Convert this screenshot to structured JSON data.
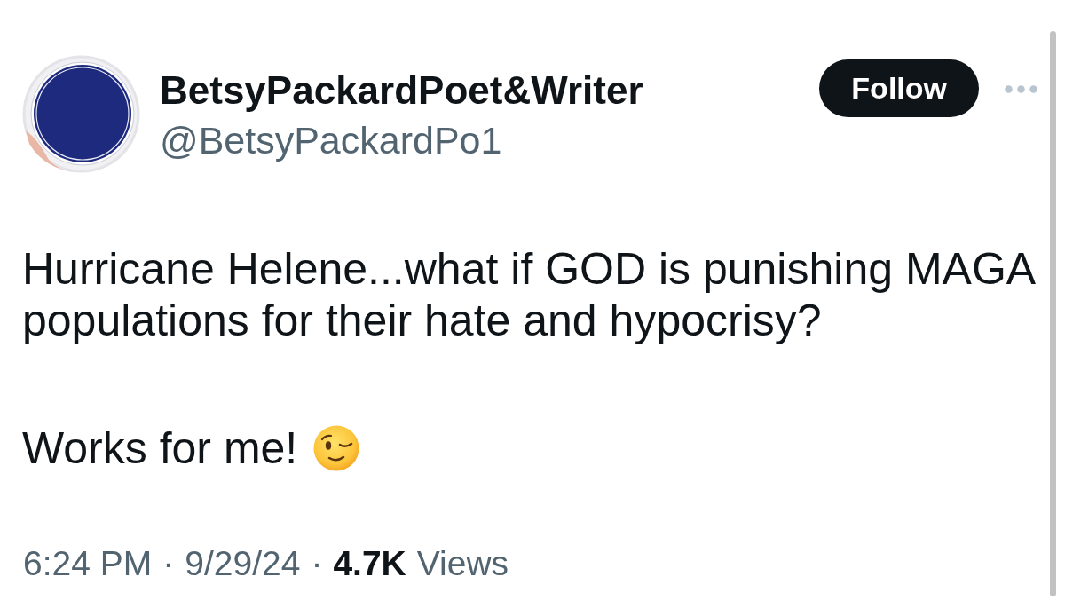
{
  "author": {
    "display_name": "BetsyPackardPoet&Writer",
    "handle": "@BetsyPackardPo1"
  },
  "follow_button": {
    "label": "Follow"
  },
  "tweet": {
    "paragraphs": [
      "Hurricane Helene...what if GOD is punishing MAGA populations for their hate and hypocrisy?",
      "Works for me!"
    ]
  },
  "meta": [
    {
      "kind": "time",
      "text": "6:24 PM"
    },
    {
      "kind": "separator",
      "text": "·"
    },
    {
      "kind": "date",
      "text": "9/29/24"
    },
    {
      "kind": "separator",
      "text": "·"
    },
    {
      "kind": "count",
      "text": "4.7K"
    },
    {
      "kind": "label",
      "text": "Views"
    }
  ]
}
